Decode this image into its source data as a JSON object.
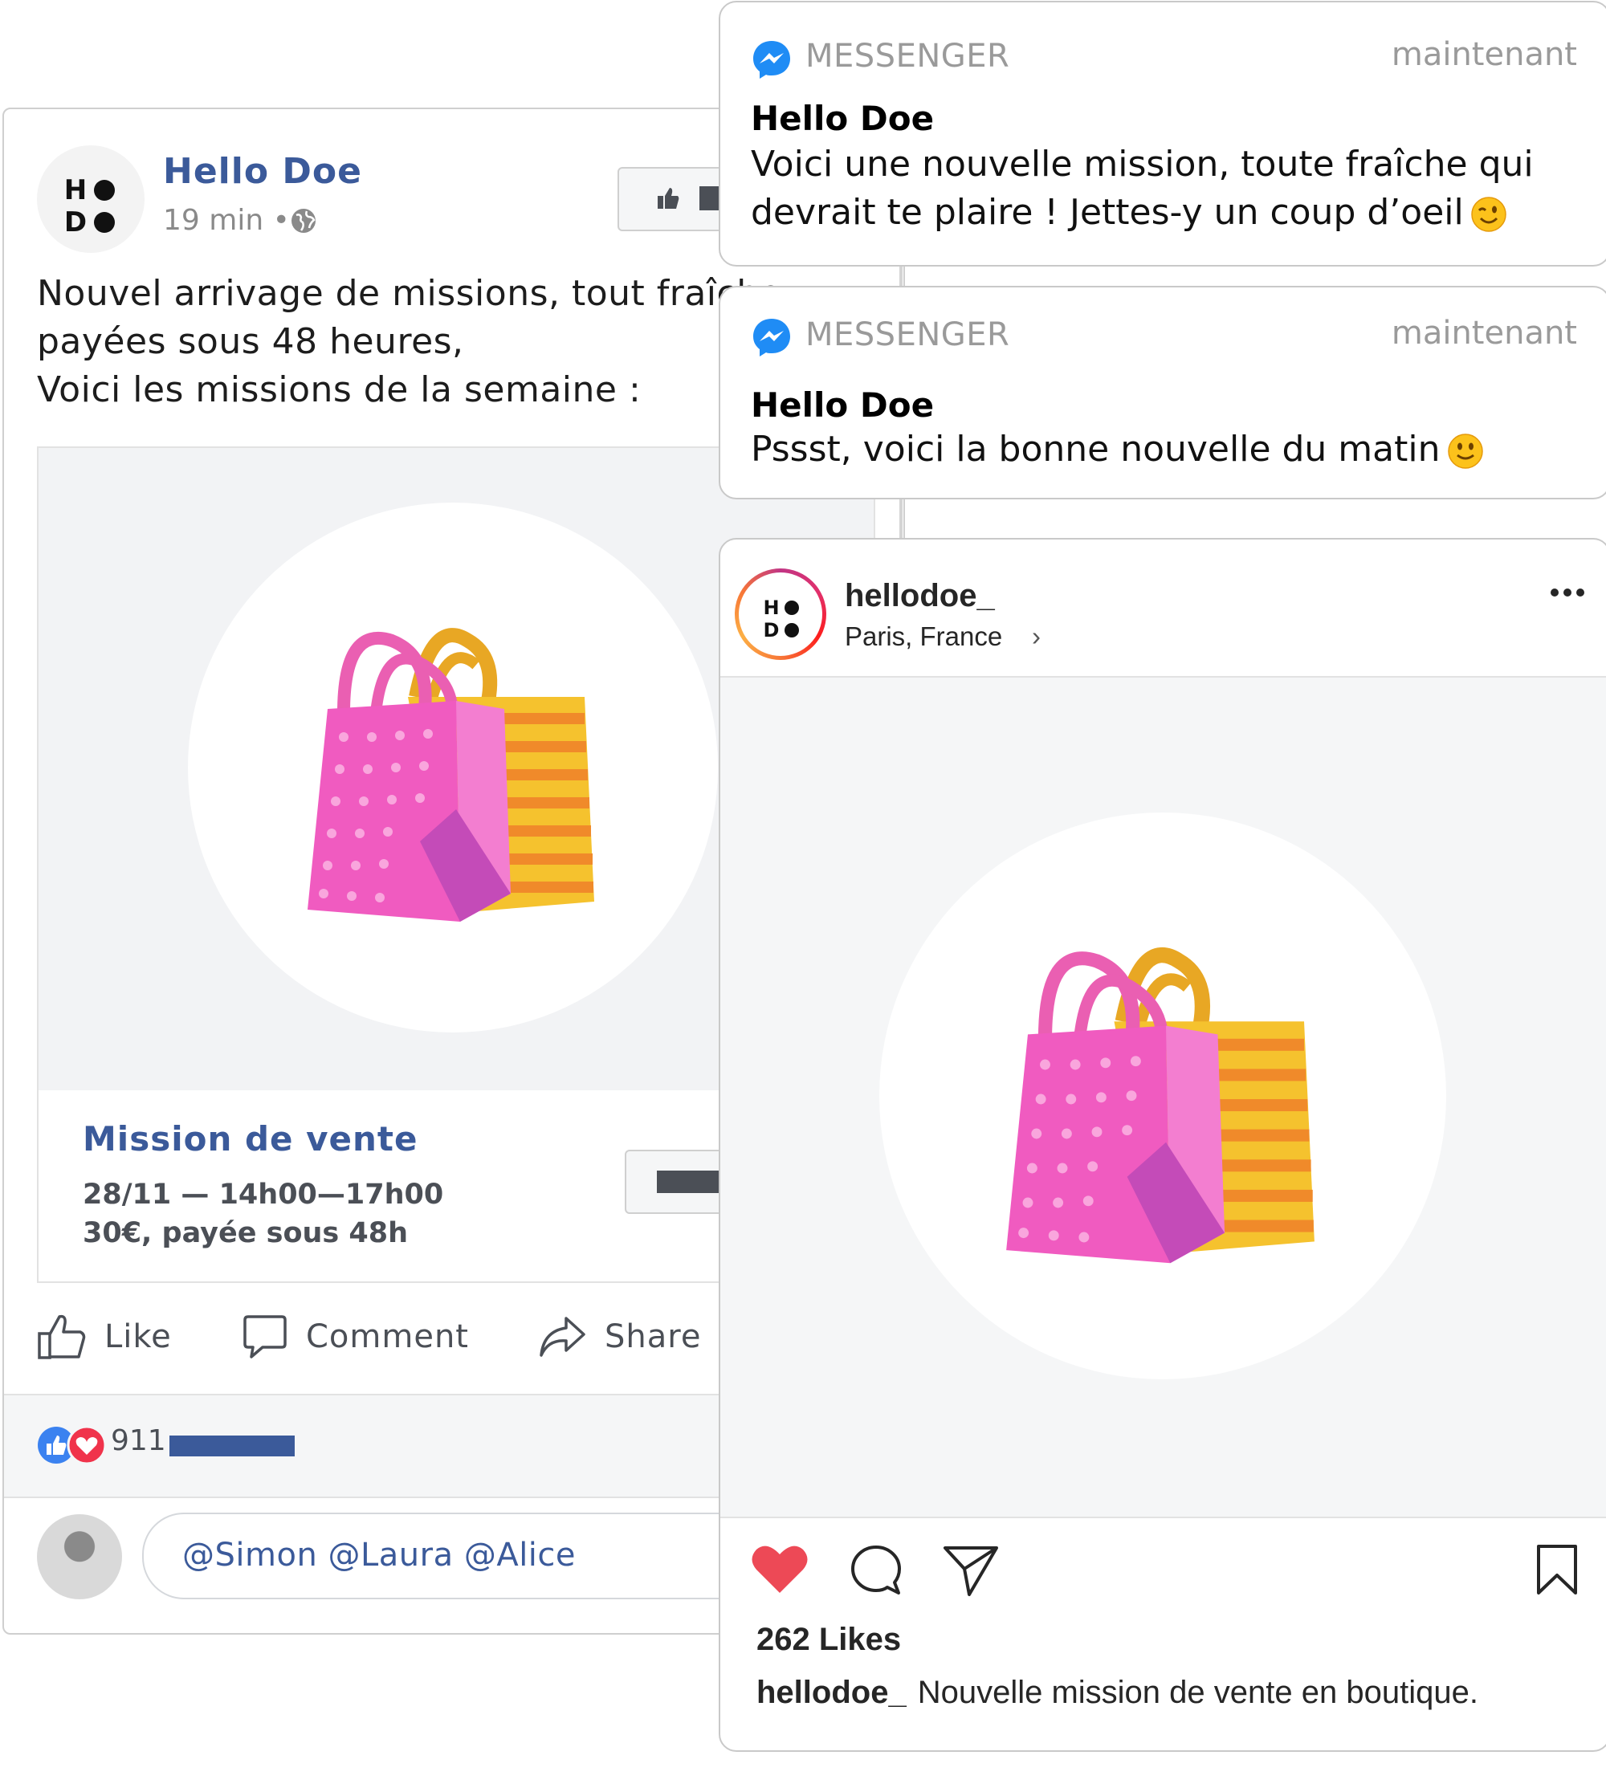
{
  "facebook_post": {
    "page_name": "Hello Doe",
    "time": "19 min •",
    "text_lines": [
      "Nouvel arrivage de missions, tout fraîche",
      "payées sous 48 heures,",
      "Voici les missions de la semaine :"
    ],
    "link": {
      "title": "Mission de vente",
      "date": "28/11 — 14h00—17h00",
      "pay": "30€, payée sous 48h"
    },
    "actions": {
      "like": "Like",
      "comment": "Comment",
      "share": "Share"
    },
    "reactions_count": "911",
    "comment_input_value": "@Simon @Laura @Alice",
    "brand_color": "#3b5a9a"
  },
  "logo": {
    "letters": [
      "H",
      "D"
    ]
  },
  "notifications": [
    {
      "app": "MESSENGER",
      "time": "maintenant",
      "sender": "Hello Doe",
      "body_lines": [
        "Voici une nouvelle mission, toute fraîche qui",
        "devrait te plaire ! Jettes-y un coup d’oeil"
      ],
      "emoji": "winking-face"
    },
    {
      "app": "MESSENGER",
      "time": "maintenant",
      "sender": "Hello Doe",
      "body_lines": [
        "Pssst, voici la bonne nouvelle du matin"
      ],
      "emoji": "slightly-smiling-face"
    }
  ],
  "instagram_post": {
    "username": "hellodoe_",
    "location": "Paris, France",
    "location_chevron": "›",
    "likes": "262 Likes",
    "caption_user": "hellodoe_",
    "caption_text": "Nouvelle mission de vente en boutique.",
    "heart_color": "#ed4956"
  }
}
